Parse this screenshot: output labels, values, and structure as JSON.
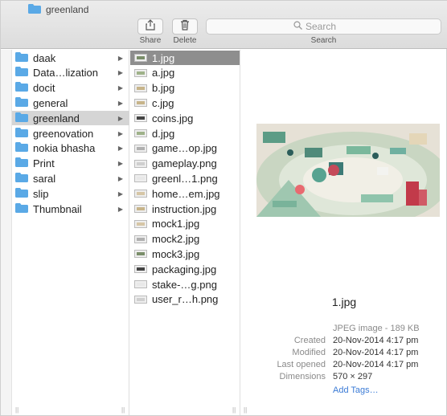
{
  "window": {
    "title": "greenland"
  },
  "toolbar": {
    "share_label": "Share",
    "delete_label": "Delete",
    "search_placeholder": "Search",
    "search_label": "Search"
  },
  "folders": [
    {
      "label": "daak"
    },
    {
      "label": "Data…lization"
    },
    {
      "label": "docit"
    },
    {
      "label": "general"
    },
    {
      "label": "greenland",
      "selected": true
    },
    {
      "label": "greenovation"
    },
    {
      "label": "nokia bhasha"
    },
    {
      "label": "Print"
    },
    {
      "label": "saral"
    },
    {
      "label": "slip"
    },
    {
      "label": "Thumbnail"
    }
  ],
  "files": [
    {
      "label": "1.jpg",
      "selected": true,
      "thumb": "t1"
    },
    {
      "label": "a.jpg",
      "thumb": "t2"
    },
    {
      "label": "b.jpg",
      "thumb": "t3"
    },
    {
      "label": "c.jpg",
      "thumb": "t3"
    },
    {
      "label": "coins.jpg",
      "thumb": "t4"
    },
    {
      "label": "d.jpg",
      "thumb": "t2"
    },
    {
      "label": "game…op.jpg",
      "thumb": "t6"
    },
    {
      "label": "gameplay.png",
      "thumb": "t7"
    },
    {
      "label": "greenl…1.png",
      "thumb": "t8"
    },
    {
      "label": "home…em.jpg",
      "thumb": "t5"
    },
    {
      "label": "instruction.jpg",
      "thumb": "t3"
    },
    {
      "label": "mock1.jpg",
      "thumb": "t5"
    },
    {
      "label": "mock2.jpg",
      "thumb": "t6"
    },
    {
      "label": "mock3.jpg",
      "thumb": "t1"
    },
    {
      "label": "packaging.jpg",
      "thumb": "t4"
    },
    {
      "label": "stake-…g.png",
      "thumb": "t8"
    },
    {
      "label": "user_r…h.png",
      "thumb": "t7"
    }
  ],
  "preview": {
    "filename": "1.jpg",
    "kind": "JPEG image - 189 KB",
    "created_label": "Created",
    "created_value": "20-Nov-2014 4:17 pm",
    "modified_label": "Modified",
    "modified_value": "20-Nov-2014 4:17 pm",
    "last_opened_label": "Last opened",
    "last_opened_value": "20-Nov-2014 4:17 pm",
    "dimensions_label": "Dimensions",
    "dimensions_value": "570 × 297",
    "add_tags": "Add Tags…"
  },
  "colors": {
    "folder": "#5aa9e6",
    "link": "#3b7bd6",
    "selection": "#8e8e8e"
  }
}
